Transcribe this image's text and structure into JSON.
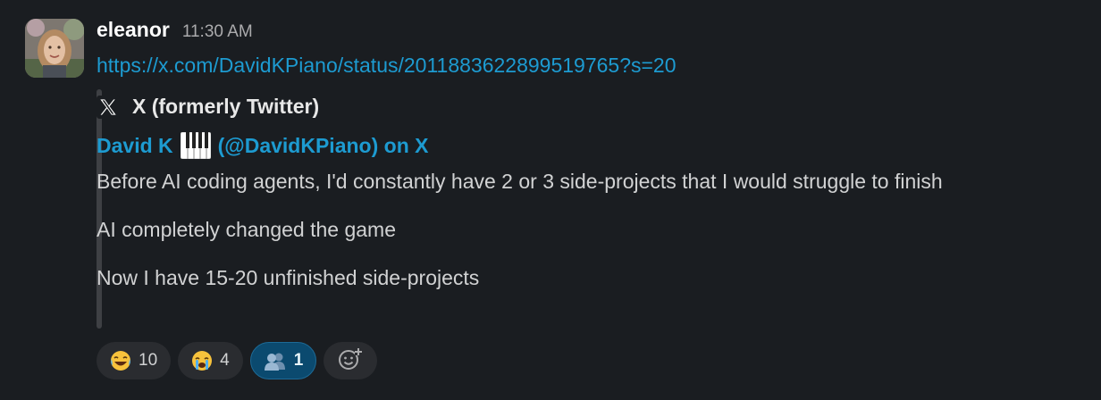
{
  "message": {
    "author": "eleanor",
    "timestamp": "11:30 AM",
    "link": "https://x.com/DavidKPiano/status/2011883622899519765?s=20"
  },
  "unfurl": {
    "service": "X (formerly Twitter)",
    "service_icon": "x-logo-icon",
    "title_prefix": "David K",
    "title_icon": "piano-keys-icon",
    "title_suffix": "(@DavidKPiano) on X",
    "paragraphs": [
      "Before AI coding agents, I'd constantly have 2 or 3 side-projects that I would struggle to finish",
      "AI completely changed the game",
      "Now I have 15-20 unfinished side-projects"
    ]
  },
  "reactions": [
    {
      "emoji": "😂",
      "name": "joy",
      "count": "10",
      "active": false
    },
    {
      "emoji": "😭",
      "name": "sob",
      "count": "4",
      "active": false
    },
    {
      "emoji": "👥",
      "name": "people",
      "count": "1",
      "active": true
    }
  ],
  "add_reaction_icon": "add-emoji-icon",
  "colors": {
    "background": "#1a1d21",
    "link": "#1d9bd1",
    "active_reaction": "#0b4a6f"
  }
}
